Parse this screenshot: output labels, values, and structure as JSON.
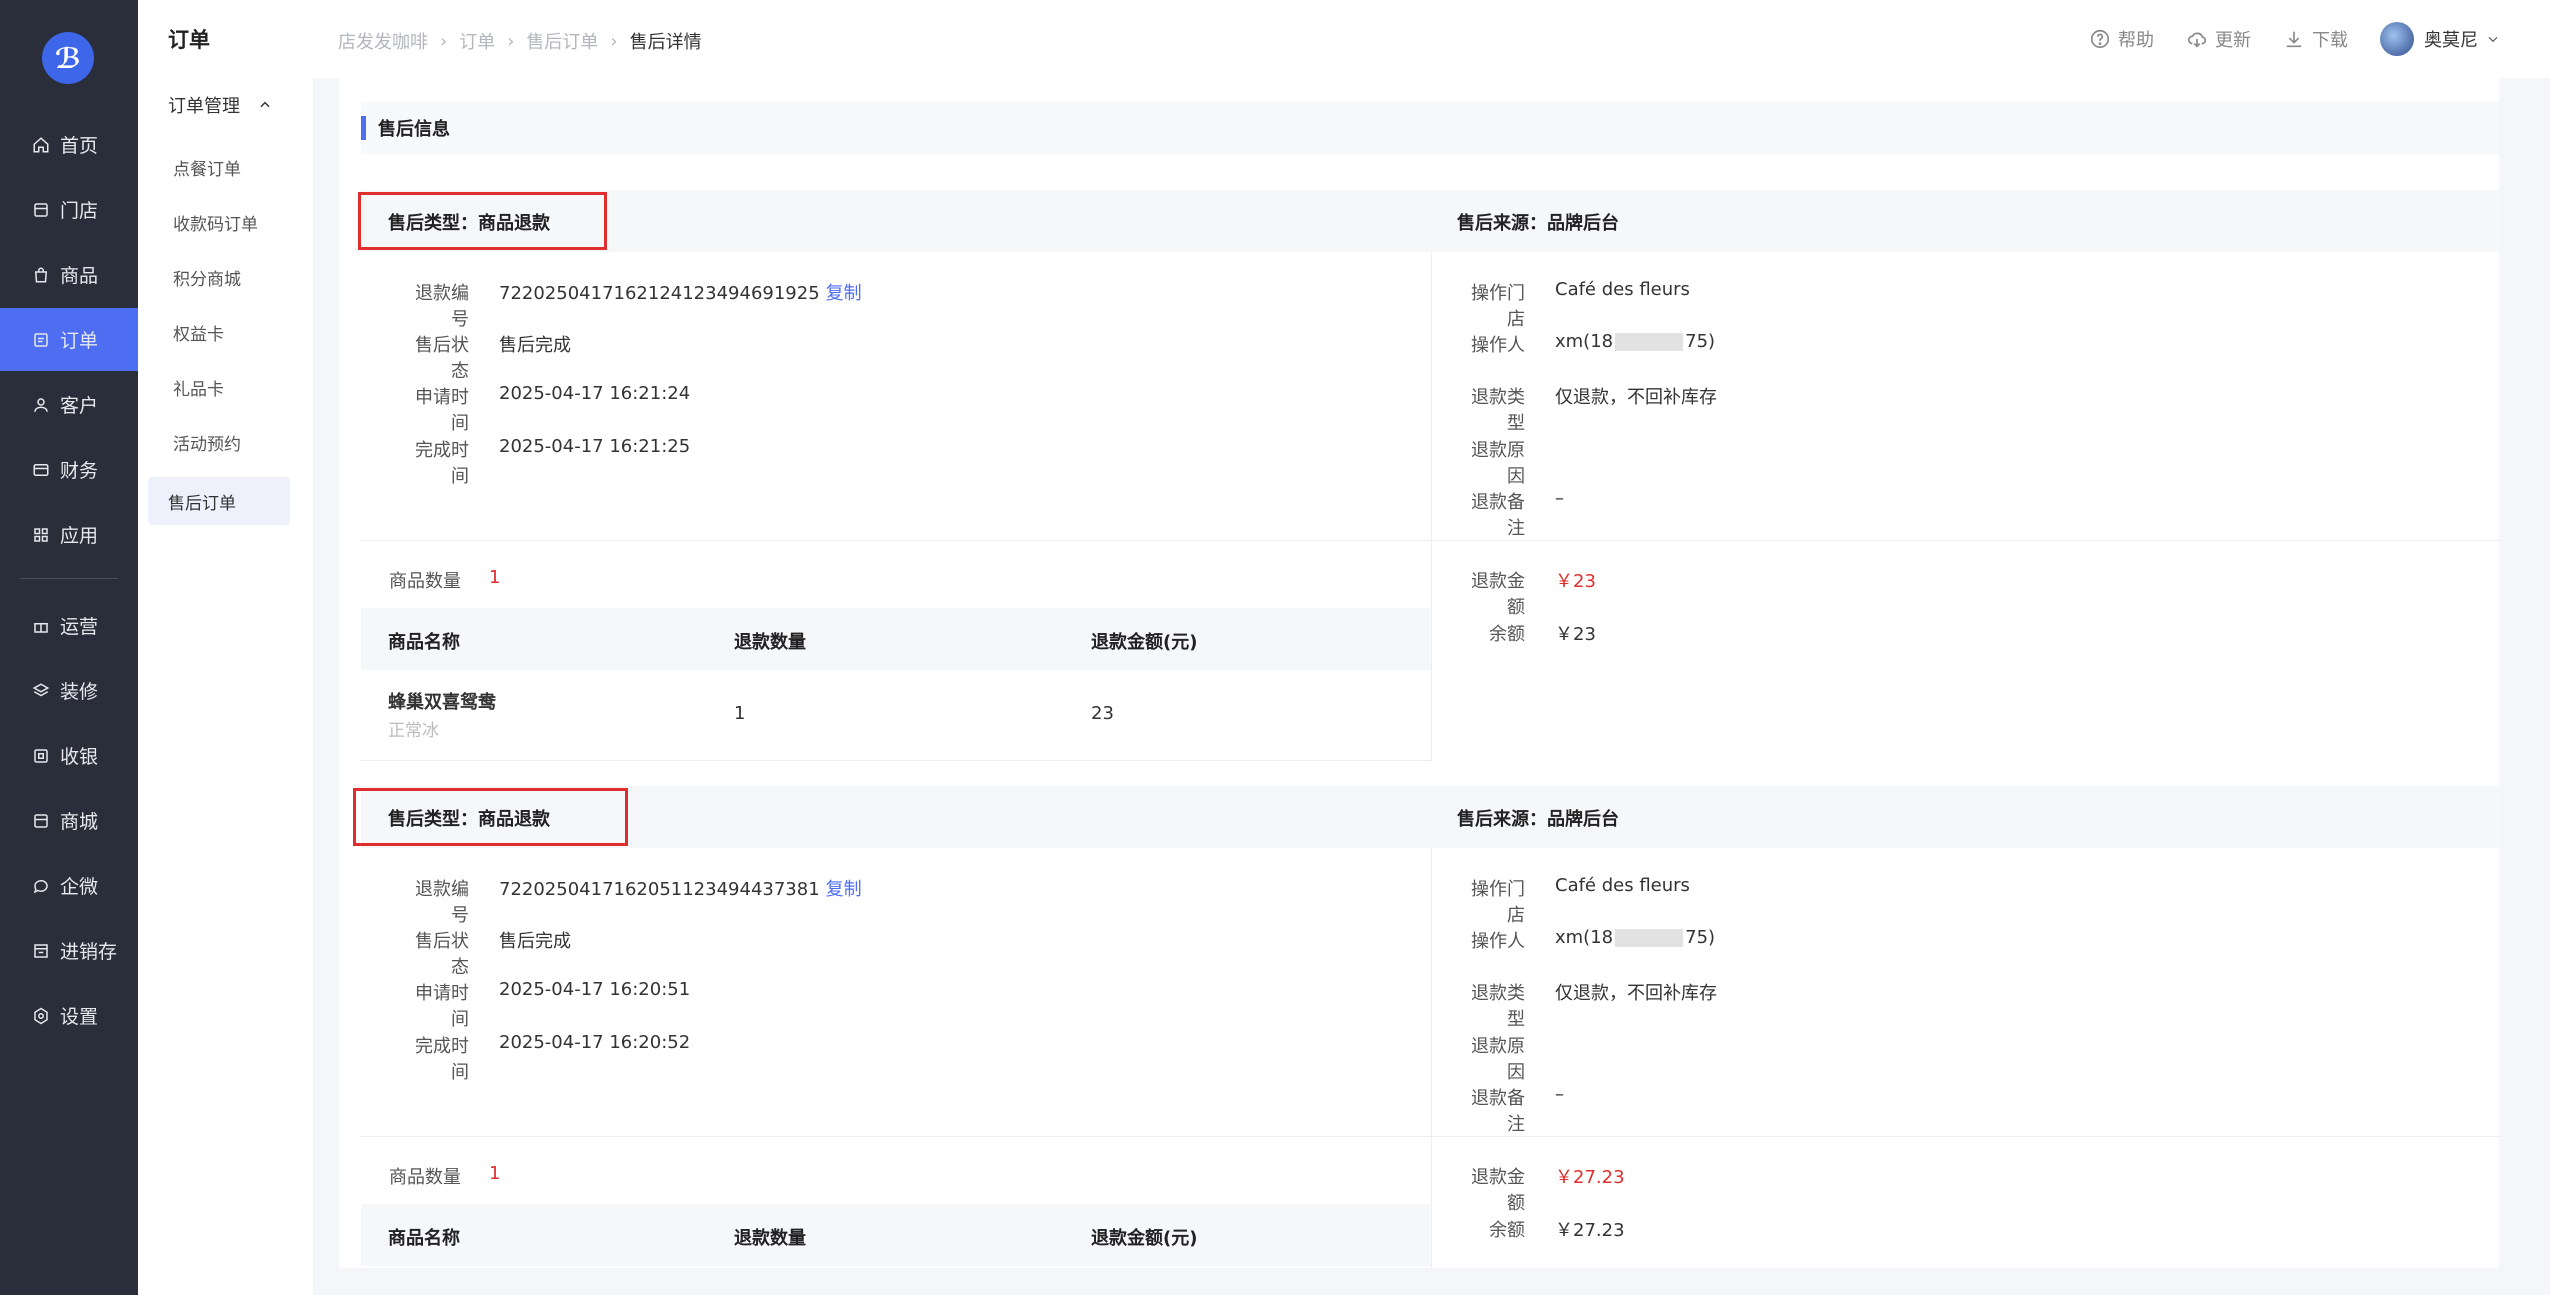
{
  "nav": {
    "items": [
      {
        "label": "首页",
        "icon": "home-icon"
      },
      {
        "label": "门店",
        "icon": "store-icon"
      },
      {
        "label": "商品",
        "icon": "bag-icon"
      },
      {
        "label": "订单",
        "icon": "order-icon"
      },
      {
        "label": "客户",
        "icon": "user-icon"
      },
      {
        "label": "财务",
        "icon": "card-icon"
      },
      {
        "label": "应用",
        "icon": "apps-icon"
      },
      {
        "label": "运营",
        "icon": "gift-icon"
      },
      {
        "label": "装修",
        "icon": "layers-icon"
      },
      {
        "label": "收银",
        "icon": "cashier-icon"
      },
      {
        "label": "商城",
        "icon": "mall-icon"
      },
      {
        "label": "企微",
        "icon": "chat-icon"
      },
      {
        "label": "进销存",
        "icon": "inventory-icon"
      },
      {
        "label": "设置",
        "icon": "settings-icon"
      }
    ],
    "active_color": "#4e6ef2"
  },
  "submenu": {
    "title": "订单",
    "group": "订单管理",
    "items": [
      "点餐订单",
      "收款码订单",
      "积分商城",
      "权益卡",
      "礼品卡",
      "活动预约",
      "售后订单"
    ]
  },
  "breadcrumb": [
    "店发发咖啡",
    "订单",
    "售后订单",
    "售后详情"
  ],
  "top_actions": {
    "help": "帮助",
    "update": "更新",
    "download": "下载",
    "user": "奥莫尼"
  },
  "section": {
    "title": "售后信息"
  },
  "labels": {
    "type": "售后类型：商品退款",
    "source": "售后来源：品牌后台",
    "refund_no": "退款编号",
    "status": "售后状态",
    "apply_time": "申请时间",
    "finish_time": "完成时间",
    "store": "操作门店",
    "operator": "操作人",
    "refund_type": "退款类型",
    "refund_reason": "退款原因",
    "refund_remark": "退款备注",
    "goods_count": "商品数量",
    "refund_amount": "退款金额",
    "balance": "余额",
    "col_name": "商品名称",
    "col_qty": "退款数量",
    "col_amount": "退款金额(元)",
    "copy": "复制"
  },
  "cards": [
    {
      "refund_no": "7220250417162124123494691925",
      "status": "售后完成",
      "apply_time": "2025-04-17 16:21:24",
      "finish_time": "2025-04-17 16:21:25",
      "store": "Café des fleurs",
      "operator_prefix": "xm(18",
      "operator_suffix": "75)",
      "refund_type": "仅退款，不回补库存",
      "refund_reason": "",
      "refund_remark": "–",
      "goods_count": "1",
      "refund_amount": "￥23",
      "balance": "￥23",
      "item": {
        "name": "蜂巢双喜鸳鸯",
        "spec": "正常冰",
        "qty": "1",
        "amount": "23"
      }
    },
    {
      "refund_no": "7220250417162051123494437381",
      "status": "售后完成",
      "apply_time": "2025-04-17 16:20:51",
      "finish_time": "2025-04-17 16:20:52",
      "store": "Café des fleurs",
      "operator_prefix": "xm(18",
      "operator_suffix": "75)",
      "refund_type": "仅退款，不回补库存",
      "refund_reason": "",
      "refund_remark": "–",
      "goods_count": "1",
      "refund_amount": "￥27.23",
      "balance": "￥27.23"
    }
  ]
}
